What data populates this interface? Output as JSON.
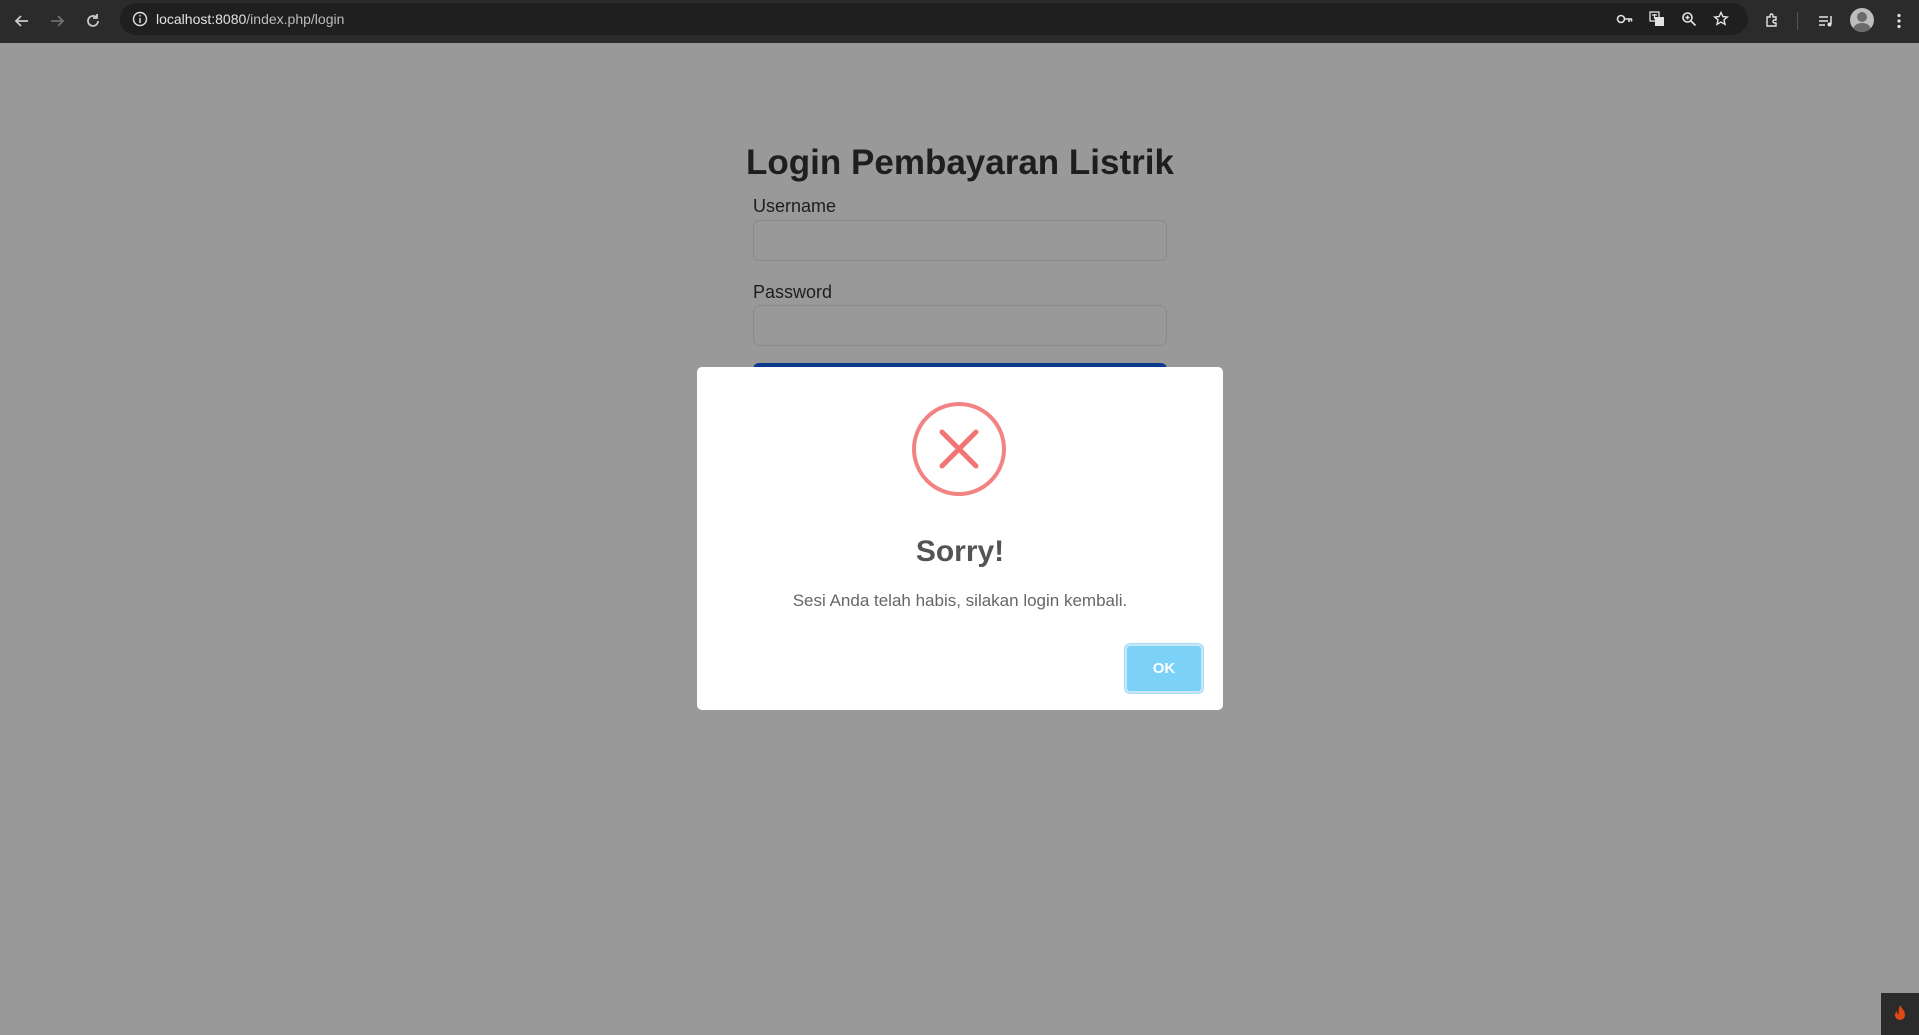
{
  "browser": {
    "url_host": "localhost:8080",
    "url_path": "/index.php/login"
  },
  "page": {
    "title": "Login Pembayaran Listrik",
    "username_label": "Username",
    "username_value": "",
    "password_label": "Password",
    "password_value": ""
  },
  "dialog": {
    "title": "Sorry!",
    "message": "Sesi Anda telah habis, silakan login kembali.",
    "ok_label": "OK",
    "icon": "error-x-icon",
    "accent_color": "#f27474",
    "button_color": "#7cd1f9"
  },
  "overlay_color": "#999999"
}
